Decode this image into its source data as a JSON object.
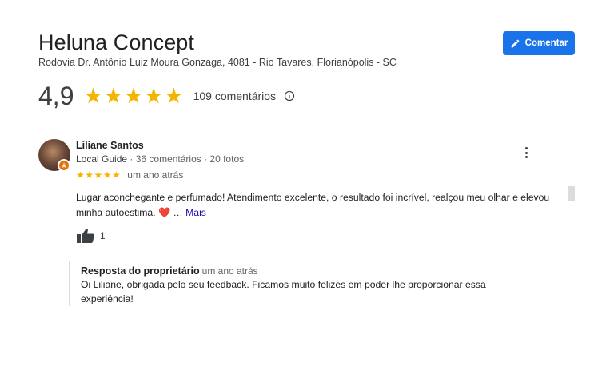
{
  "place": {
    "name": "Heluna Concept",
    "address": "Rodovia Dr. Antônio Luiz Moura Gonzaga, 4081 - Rio Tavares, Florianópolis - SC"
  },
  "actions": {
    "comment_label": "Comentar",
    "comment_icon": "pencil-icon"
  },
  "summary": {
    "rating": "4,9",
    "stars_filled": 5,
    "review_count_label": "109 comentários",
    "info_icon": "info-icon"
  },
  "review": {
    "author": "Liliane Santos",
    "author_badge": "Local Guide",
    "author_stats": " · 36 comentários · 20 fotos",
    "stars": "★★★★★",
    "date": "um ano atrás",
    "text": "Lugar aconchegante e perfumado! Atendimento excelente, o resultado foi incrível, realçou meu olhar e elevou minha autoestima.",
    "emoji": "❤️",
    "ellipsis": " …",
    "more_label": "Mais",
    "likes": "1"
  },
  "owner_reply": {
    "title": "Resposta do proprietário",
    "date": "um ano atrás",
    "text": "Oi Liliane, obrigada pelo seu feedback. Ficamos muito felizes em poder lhe proporcionar essa experiência!"
  },
  "colors": {
    "accent": "#1a73e8",
    "star": "#f4b400",
    "link": "#1a0dab",
    "local_guide_badge": "#e8710a"
  }
}
